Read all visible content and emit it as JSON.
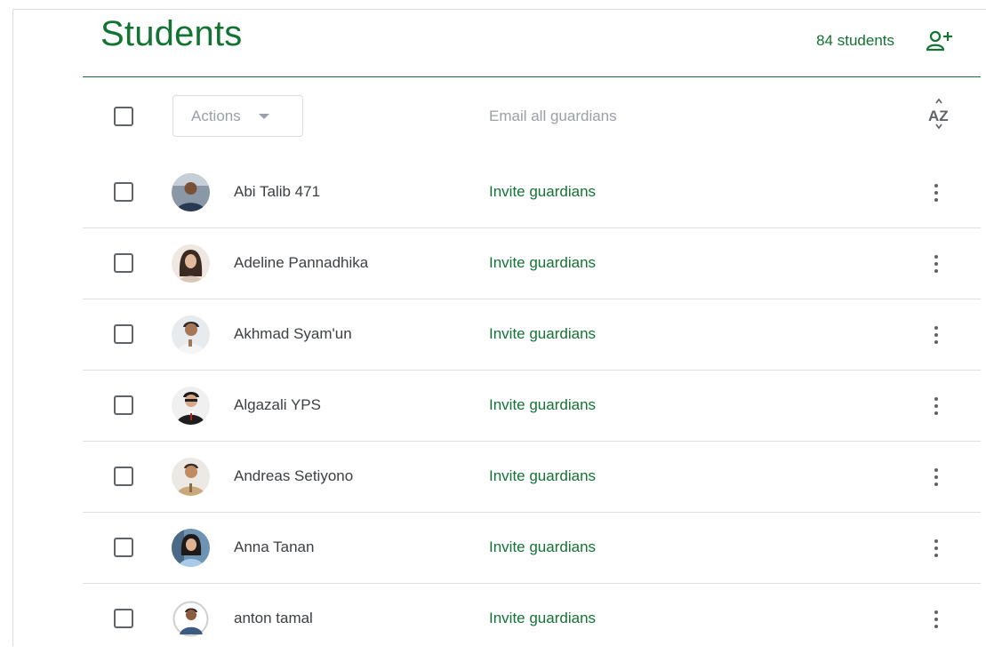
{
  "header": {
    "title": "Students",
    "count": "84 students"
  },
  "toolbar": {
    "actions_label": "Actions",
    "email_all_label": "Email all guardians",
    "sort_label": "AZ"
  },
  "students": [
    {
      "name": "Abi Talib 471",
      "invite_label": "Invite guardians"
    },
    {
      "name": "Adeline Pannadhika",
      "invite_label": "Invite guardians"
    },
    {
      "name": "Akhmad Syam'un",
      "invite_label": "Invite guardians"
    },
    {
      "name": "Algazali YPS",
      "invite_label": "Invite guardians"
    },
    {
      "name": "Andreas Setiyono",
      "invite_label": "Invite guardians"
    },
    {
      "name": "Anna Tanan",
      "invite_label": "Invite guardians"
    },
    {
      "name": "anton tamal",
      "invite_label": "Invite guardians"
    }
  ],
  "icons": {
    "invite_student": "person-add-icon",
    "sort": "sort-az-icon",
    "more": "more-vert-icon",
    "dropdown": "caret-down-icon"
  },
  "colors": {
    "accent": "#137333",
    "muted": "#9aa0a6",
    "text": "#3c4043",
    "divider": "#e0e0e0"
  }
}
